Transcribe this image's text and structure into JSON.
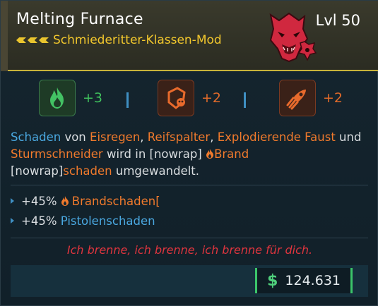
{
  "item": {
    "title": "Melting Furnace",
    "level": "Lvl 50",
    "subtitle": "Schmiederitter-Klassen-Mod"
  },
  "perks": [
    {
      "value": "+3",
      "icon": "fire-burst-icon",
      "color": "#3fbf5c"
    },
    {
      "value": "+2",
      "icon": "helmet-skull-icon",
      "color": "#e06a2a"
    },
    {
      "value": "+2",
      "icon": "rocket-comet-icon",
      "color": "#e06a2a"
    }
  ],
  "description": {
    "w1": "Schaden",
    "w2": " von ",
    "w3": "Eisregen",
    "w4": ", ",
    "w5": "Reifspalter",
    "w6": ", ",
    "w7": "Explodierende Faust",
    "w8": " und ",
    "w9": "Sturmschneider",
    "w10": " wird in [nowrap] ",
    "w11": "Brand",
    "w12": "[nowrap]",
    "w13": "schaden",
    "w14": " umgewandelt."
  },
  "stats": [
    {
      "prefix": "+45% ",
      "label": "Brandschaden[",
      "has_flame": true
    },
    {
      "prefix": "+45% ",
      "label": "Pistolenschaden",
      "has_flame": false
    }
  ],
  "flavor": "Ich brenne, ich brenne, ich brenne für dich.",
  "price": {
    "currency": "$",
    "value": "124.631"
  },
  "colors": {
    "gold": "#f2c72d",
    "blue": "#4aa8e0",
    "orange": "#f07a2c",
    "red": "#e0353e",
    "green": "#4fd07c"
  }
}
